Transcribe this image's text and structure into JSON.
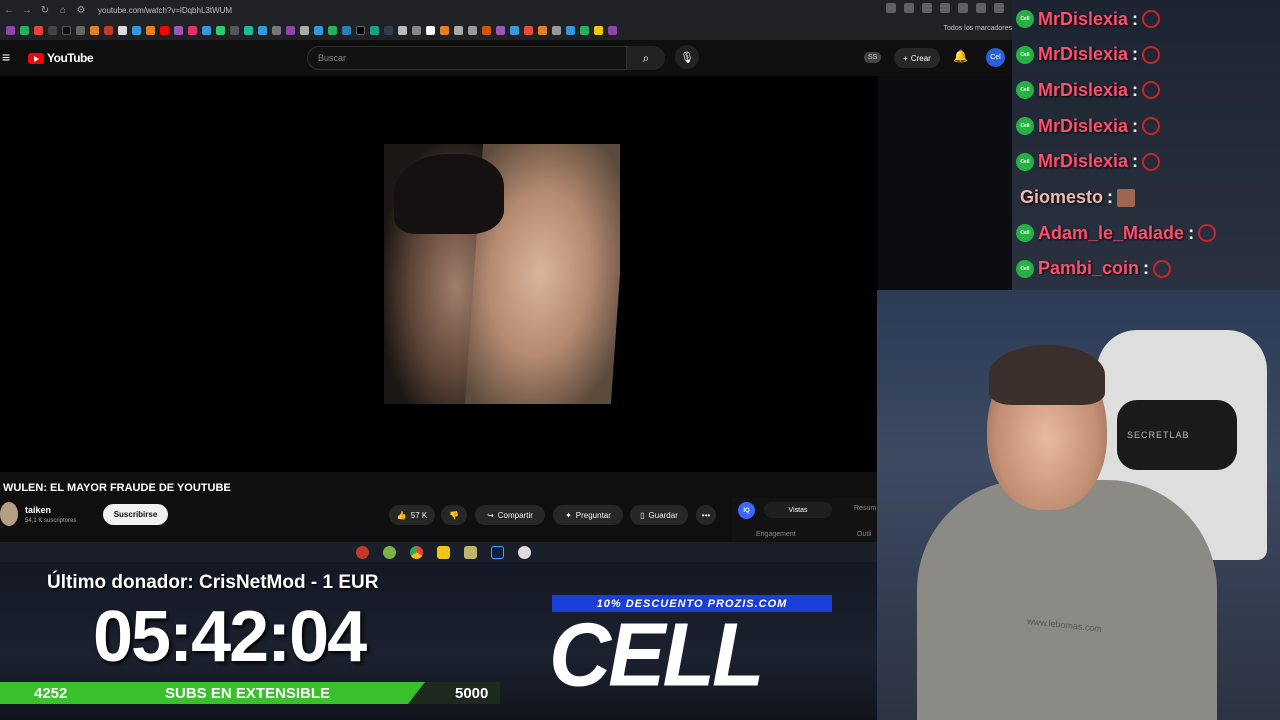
{
  "browser": {
    "url": "youtube.com/watch?v=lDqbhL3tWUM",
    "all_bookmarks": "Todos los marcadores"
  },
  "youtube": {
    "logo_text": "YouTube",
    "search_placeholder": "Buscar",
    "ss_badge": "SS",
    "create_label": "Crear",
    "avatar_text": "Cel"
  },
  "video": {
    "title": "WULEN: EL MAYOR FRAUDE DE YOUTUBE",
    "channel_name": "taiken",
    "subscribers": "54,1 K suscriptores",
    "subscribe_label": "Suscribirse",
    "likes": "57 K",
    "share_label": "Compartir",
    "ask_label": "Preguntar",
    "save_label": "Guardar"
  },
  "extension": {
    "logo": "IQ",
    "tab_active": "Vistas",
    "tab_other": "Resum",
    "engagement_label": "Engagement",
    "outlier_label": "Outli"
  },
  "overlay": {
    "donor_text": "Último donador: CrisNetMod - 1 EUR",
    "timer": "05:42:04",
    "subs_current": "4252",
    "subs_label": "SUBS EN EXTENSIBLE",
    "subs_goal": "5000",
    "subs_progress": 0.85,
    "promo_text": "10% DESCUENTO PROZIS.COM",
    "sponsor": "CELL"
  },
  "chat": {
    "badge_text": "Cell",
    "messages": [
      {
        "user": "MrDislexia",
        "color": "#ff4d6d"
      },
      {
        "user": "MrDislexia",
        "color": "#ff4d6d"
      },
      {
        "user": "MrDislexia",
        "color": "#ff4d6d"
      },
      {
        "user": "MrDislexia",
        "color": "#ff4d6d"
      },
      {
        "user": "MrDislexia",
        "color": "#ff4d6d"
      },
      {
        "user": "Giomesto",
        "color": "#f0b8a8"
      },
      {
        "user": "Adam_le_Malade",
        "color": "#ff4d6d"
      },
      {
        "user": "Pambi_coin",
        "color": "#ff4d6d"
      }
    ],
    "separator": ":"
  },
  "webcam": {
    "chair_brand": "SECRETLAB",
    "shirt_text": "www.lebomas.com"
  },
  "colors": {
    "yt_red": "#ff0000",
    "subs_green": "#38c12a",
    "promo_blue": "#1a3fd6",
    "chat_badge_green": "#27b043"
  }
}
